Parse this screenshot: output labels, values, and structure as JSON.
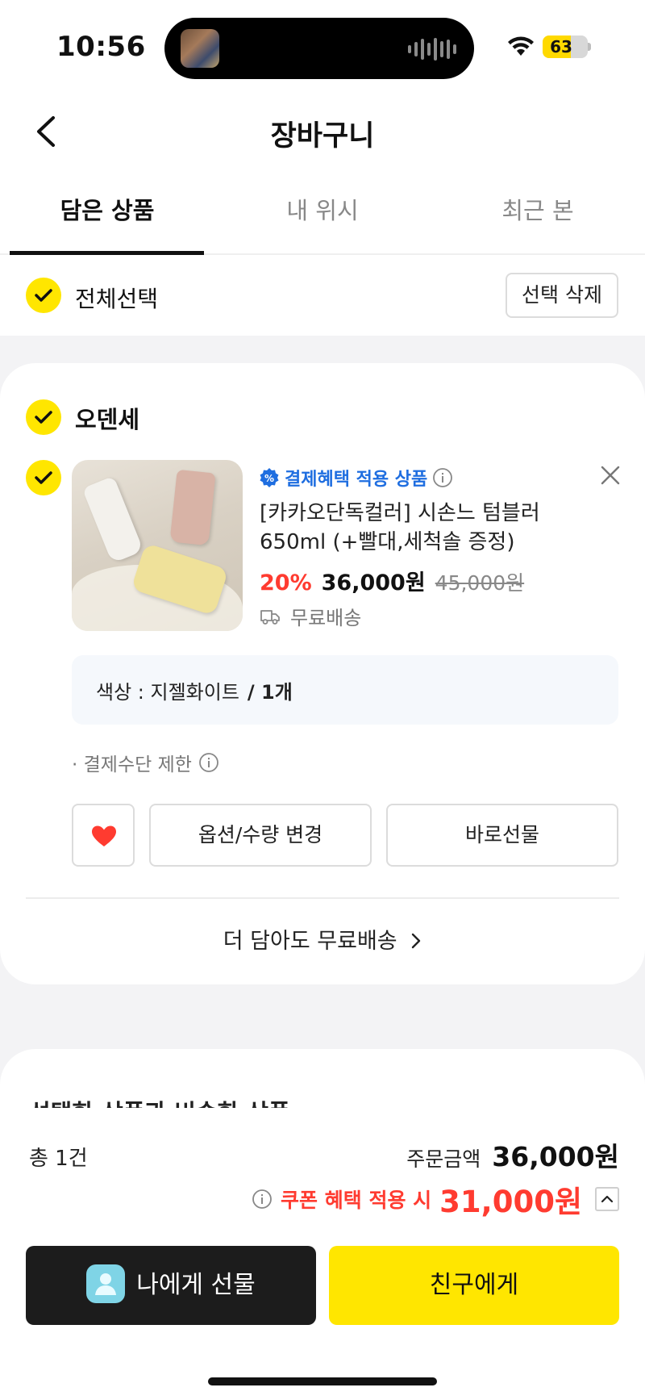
{
  "status_bar": {
    "time": "10:56",
    "battery_level": 63,
    "battery_label": "63",
    "icons": [
      "dynamic-island-artwork-icon",
      "audio-waveform-icon",
      "wifi-icon",
      "battery-icon"
    ]
  },
  "header": {
    "title": "장바구니",
    "back_icon": "chevron-left-icon"
  },
  "tabs": [
    {
      "label": "담은 상품",
      "active": true
    },
    {
      "label": "내 위시",
      "active": false
    },
    {
      "label": "최근 본",
      "active": false
    }
  ],
  "select_all": {
    "label": "전체선택",
    "checked": true,
    "delete_label": "선택 삭제"
  },
  "store": {
    "name": "오덴세",
    "checked": true,
    "item": {
      "checked": true,
      "badge": "결제혜택 적용 상품",
      "name": "[카카오단독컬러] 시손느 텀블러 650ml (+빨대,세척솔 증정)",
      "discount": "20%",
      "price": "36,000원",
      "original_price": "45,000원",
      "shipping": "무료배송",
      "option_label": "색상 : 지젤화이트",
      "quantity": "/ 1개",
      "payment_limit": "· 결제수단 제한",
      "wished": true,
      "change_option_label": "옵션/수량 변경",
      "gift_now_label": "바로선물"
    },
    "more_free_shipping": "더 담아도 무료배송"
  },
  "similar_section": {
    "title": "선택한 상품과 비슷한 상품"
  },
  "summary": {
    "count": "총 1건",
    "order_amount_label": "주문금액",
    "order_amount": "36,000원",
    "coupon_label": "쿠폰 혜택 적용 시",
    "coupon_amount": "31,000원"
  },
  "cta": {
    "self_gift": "나에게 선물",
    "friend_gift": "친구에게"
  },
  "colors": {
    "accent_yellow": "#ffe600",
    "discount_red": "#ff3b30",
    "badge_blue": "#1f6ee0",
    "dark_button": "#1c1c1c"
  }
}
